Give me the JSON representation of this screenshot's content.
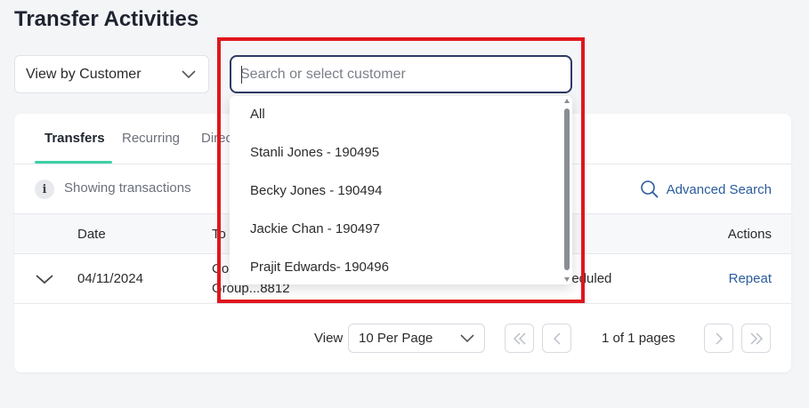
{
  "page": {
    "title": "Transfer Activities"
  },
  "filters": {
    "view_by": "View by Customer",
    "search_placeholder": "Search or select customer"
  },
  "tabs": [
    {
      "label": "Transfers",
      "active": true
    },
    {
      "label": "Recurring",
      "active": false
    },
    {
      "label": "Direc",
      "active": false
    }
  ],
  "info": {
    "text": "Showing transactions",
    "advanced_search": "Advanced Search"
  },
  "table": {
    "headers": {
      "date": "Date",
      "to": "To",
      "actions": "Actions"
    },
    "rows": [
      {
        "date": "04/11/2024",
        "to_line1": "Co",
        "to_line2": "Group...8812",
        "status": "neduled",
        "action": "Repeat"
      }
    ]
  },
  "pagination": {
    "view_label": "View",
    "per_page": "10 Per Page",
    "page_info": "1 of 1 pages"
  },
  "dropdown": {
    "options": [
      "All",
      "Stanli Jones - 190495",
      "Becky Jones - 190494",
      "Jackie Chan - 190497",
      "Prajit Edwards- 190496"
    ]
  },
  "colors": {
    "accent_tab": "#3dd0a6",
    "link": "#2b5c9b",
    "highlight_border": "#e0161d",
    "search_border": "#2d3a66"
  }
}
